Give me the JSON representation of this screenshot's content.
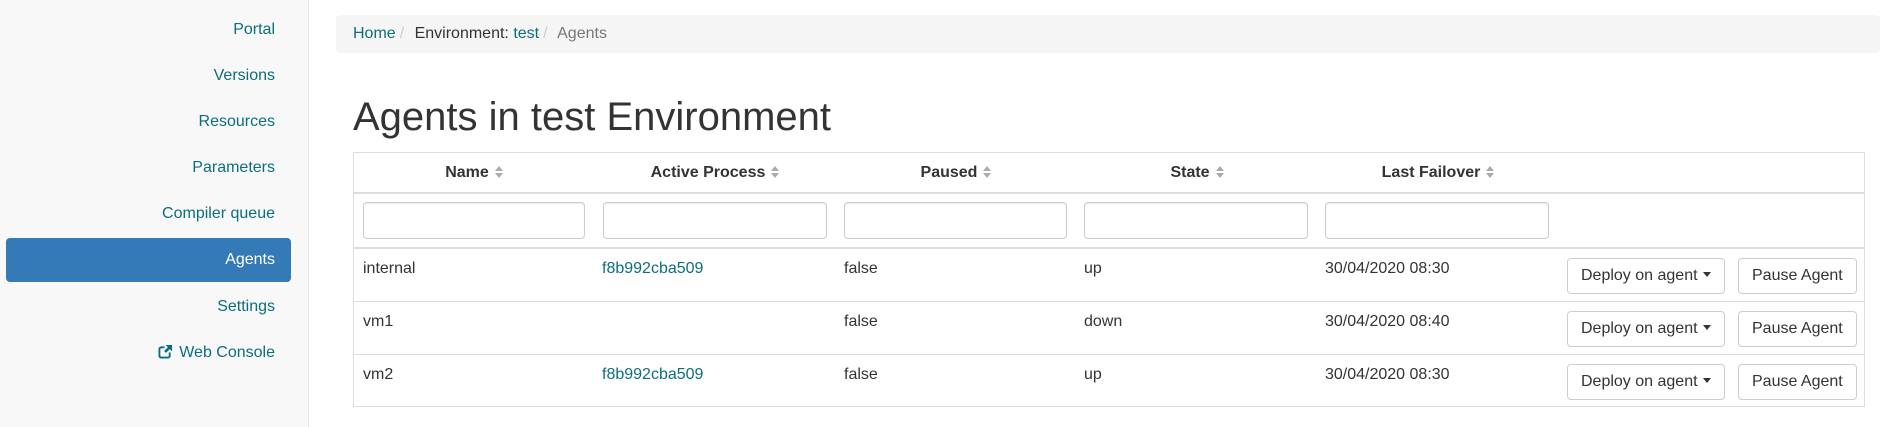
{
  "sidebar": {
    "items": [
      {
        "label": "Portal"
      },
      {
        "label": "Versions"
      },
      {
        "label": "Resources"
      },
      {
        "label": "Parameters"
      },
      {
        "label": "Compiler queue"
      },
      {
        "label": "Agents",
        "active": true
      },
      {
        "label": "Settings"
      },
      {
        "label": "Web Console",
        "icon": "external-link-icon"
      }
    ]
  },
  "breadcrumb": {
    "home": "Home",
    "env_prefix": "Environment:",
    "env_name": "test",
    "current": "Agents"
  },
  "page": {
    "title": "Agents in test Environment"
  },
  "table": {
    "columns": [
      "Name",
      "Active Process",
      "Paused",
      "State",
      "Last Failover"
    ],
    "sort_icon": "sort-both-icon",
    "filter_values": [
      "",
      "",
      "",
      "",
      ""
    ],
    "rows": [
      {
        "name": "internal",
        "process": "f8b992cba509",
        "paused": "false",
        "state": "up",
        "failover": "30/04/2020 08:30"
      },
      {
        "name": "vm1",
        "process": "",
        "paused": "false",
        "state": "down",
        "failover": "30/04/2020 08:40"
      },
      {
        "name": "vm2",
        "process": "f8b992cba509",
        "paused": "false",
        "state": "up",
        "failover": "30/04/2020 08:30"
      }
    ],
    "deploy_label": "Deploy on agent",
    "pause_label": "Pause Agent"
  },
  "colors": {
    "link": "#0b6e7e",
    "active_bg": "#337ab7",
    "sidebar_bg": "#f8f8f8"
  }
}
